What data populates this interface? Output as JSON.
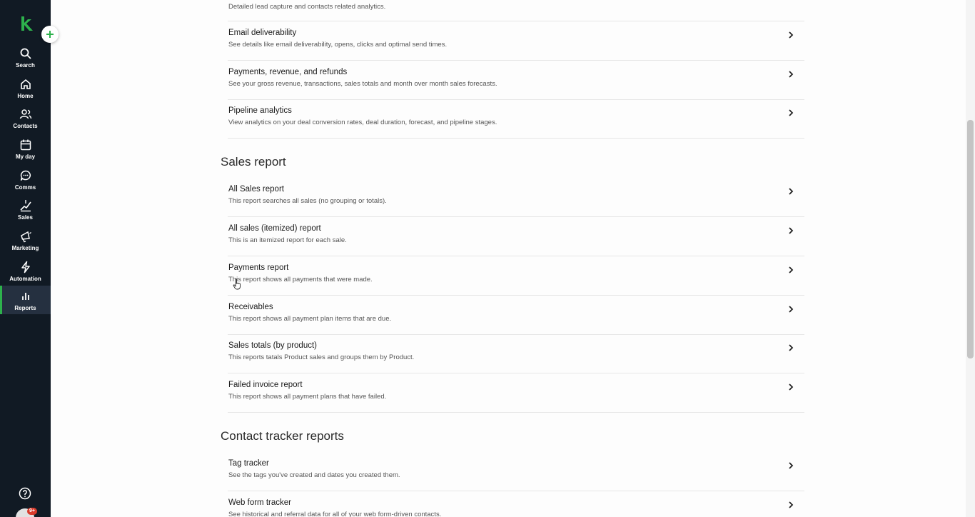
{
  "colors": {
    "sidebar_bg": "#111a24",
    "accent": "#2db14c",
    "text_primary": "#1b1b1b",
    "text_secondary": "#555555"
  },
  "sidebar": {
    "items": [
      {
        "label": "Search",
        "icon": "search-icon"
      },
      {
        "label": "Home",
        "icon": "home-icon"
      },
      {
        "label": "Contacts",
        "icon": "contacts-icon"
      },
      {
        "label": "My day",
        "icon": "calendar-icon"
      },
      {
        "label": "Comms",
        "icon": "chat-icon"
      },
      {
        "label": "Sales",
        "icon": "sales-icon"
      },
      {
        "label": "Marketing",
        "icon": "megaphone-icon"
      },
      {
        "label": "Automation",
        "icon": "lightning-icon"
      },
      {
        "label": "Reports",
        "icon": "bar-chart-icon",
        "active": true
      }
    ],
    "avatar_badge": "9+"
  },
  "top_partial": {
    "description": "Detailed lead capture and contacts related analytics."
  },
  "analytics_rows": [
    {
      "title": "Email deliverability",
      "description": "See details like email deliverability, opens, clicks and optimal send times."
    },
    {
      "title": "Payments, revenue, and refunds",
      "description": "See your gross revenue, transactions, sales totals and month over month sales forecasts."
    },
    {
      "title": "Pipeline analytics",
      "description": "View analytics on your deal conversion rates, deal duration, forecast, and pipeline stages."
    }
  ],
  "sales_section": {
    "title": "Sales report",
    "rows": [
      {
        "title": "All Sales report",
        "description": "This report searches all sales (no grouping or totals)."
      },
      {
        "title": "All sales (itemized) report",
        "description": "This is an itemized report for each sale."
      },
      {
        "title": "Payments report",
        "description": "This report shows all payments that were made."
      },
      {
        "title": "Receivables",
        "description": "This report shows all payment plan items that are due."
      },
      {
        "title": "Sales totals (by product)",
        "description": "This reports tatals Product sales and groups them by Product."
      },
      {
        "title": "Failed invoice report",
        "description": "This report shows all payment plans that have failed."
      }
    ]
  },
  "contact_section": {
    "title": "Contact tracker reports",
    "rows": [
      {
        "title": "Tag tracker",
        "description": "See the tags you've created and dates you created them."
      },
      {
        "title": "Web form tracker",
        "description": "See historical and referral data for all of your web form-driven contacts."
      }
    ]
  }
}
